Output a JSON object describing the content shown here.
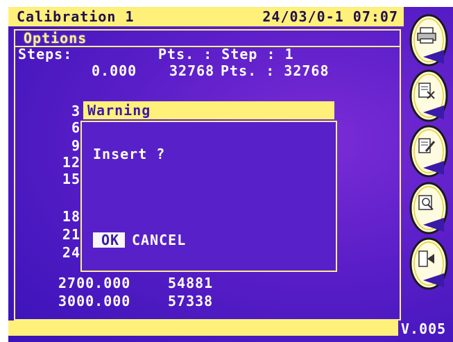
{
  "header": {
    "title": "Calibration 1",
    "datetime": "24/03/0-1 07:07"
  },
  "options_label": "Options",
  "steps_row": {
    "steps_label": "Steps:",
    "pts_step": "Pts. : Step : 1"
  },
  "first_row": {
    "value": "0.000",
    "pts": "32768",
    "pts_label": "Pts. : 32768"
  },
  "partial_rows": [
    "3",
    "6",
    "9",
    "12",
    "15",
    "18",
    "21",
    "24"
  ],
  "table_rows": [
    {
      "value": "2700.000",
      "pts": "54881"
    },
    {
      "value": "3000.000",
      "pts": "57338"
    }
  ],
  "dialog": {
    "title": "Warning",
    "message": "Insert ?",
    "ok_label": "OK",
    "cancel_label": "CANCEL"
  },
  "footer": {
    "version": "V.005"
  },
  "softkeys": [
    {
      "icon": "printer-icon"
    },
    {
      "icon": "delete-doc-icon"
    },
    {
      "icon": "edit-doc-icon"
    },
    {
      "icon": "search-doc-icon"
    },
    {
      "icon": "exit-icon"
    }
  ],
  "colors": {
    "background": "#5a1ec8",
    "accent_yellow": "#fff07a",
    "text_white": "#ffffff"
  }
}
